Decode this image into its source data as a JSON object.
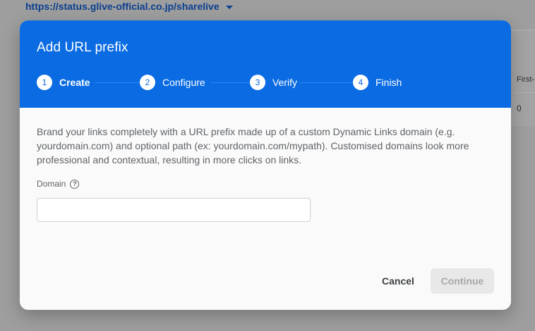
{
  "background": {
    "url": "https://status.glive-official.co.jp/sharelive",
    "column_header": "First-",
    "cell_value": "0"
  },
  "dialog": {
    "title": "Add URL prefix",
    "header_color": "#0a6be3",
    "steps": [
      {
        "number": "1",
        "label": "Create",
        "active": true
      },
      {
        "number": "2",
        "label": "Configure",
        "active": false
      },
      {
        "number": "3",
        "label": "Verify",
        "active": false
      },
      {
        "number": "4",
        "label": "Finish",
        "active": false
      }
    ],
    "description": "Brand your links completely with a URL prefix made up of a custom Dynamic Links domain (e.g. yourdomain.com) and optional path (ex: yourdomain.com/mypath). Customised domains look more professional and contextual, resulting in more clicks on links.",
    "domain_label": "Domain",
    "help_icon": "help-circle-icon",
    "domain_value": "",
    "domain_placeholder": "",
    "cancel_label": "Cancel",
    "continue_label": "Continue"
  }
}
